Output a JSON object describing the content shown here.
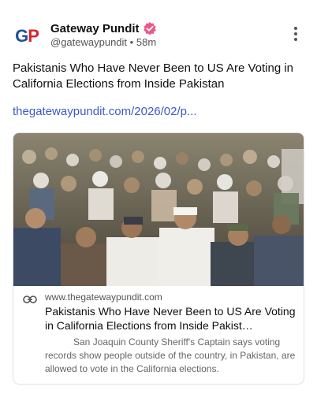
{
  "post": {
    "account": {
      "avatar_initials_blue": "G",
      "avatar_initials_red": "P",
      "name": "Gateway Pundit",
      "handle": "@gatewaypundit",
      "separator": "•",
      "time_ago": "58m",
      "verified_color": "#e85a8a"
    },
    "title": "Pakistanis Who Have Never Been to US Are Voting in California Elections from Inside Pakistan",
    "link_text": "thegatewaypundit.com/2026/02/p...",
    "link_color": "#3a5bc7"
  },
  "card": {
    "domain": "www.thegatewaypundit.com",
    "title": "Pakistanis Who Have Never Been to US Are Voting in California Elections from Inside Pakist…",
    "description": "San Joaquin County Sheriff's Captain says voting records show people outside of the country, in Pakistan, are allowed to vote in the California elections.",
    "image_alt_icon": "crowd-photo"
  }
}
